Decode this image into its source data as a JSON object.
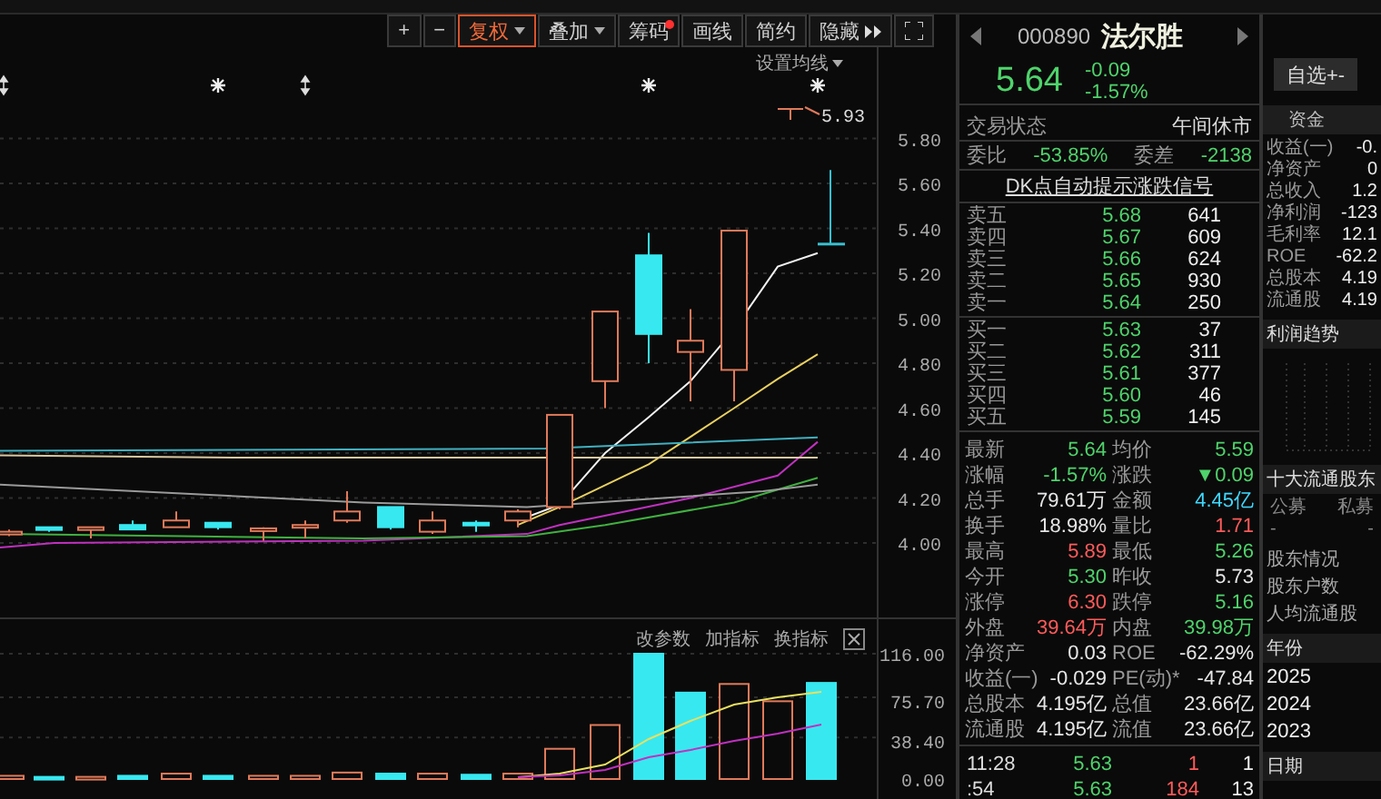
{
  "toolbar": {
    "buttons": [
      {
        "label": "+",
        "selected": false,
        "dropdown": false,
        "badge": false
      },
      {
        "label": "−",
        "selected": false,
        "dropdown": false,
        "badge": false
      },
      {
        "label": "复权",
        "selected": true,
        "dropdown": true,
        "badge": false
      },
      {
        "label": "叠加",
        "selected": false,
        "dropdown": true,
        "badge": false
      },
      {
        "label": "筹码",
        "selected": false,
        "dropdown": false,
        "badge": true
      },
      {
        "label": "画线",
        "selected": false,
        "dropdown": false,
        "badge": false
      },
      {
        "label": "简约",
        "selected": false,
        "dropdown": false,
        "badge": false
      },
      {
        "label": "隐藏",
        "selected": false,
        "dropdown": false,
        "badge": false
      }
    ]
  },
  "price_chart": {
    "ma_settings": "设置均线",
    "high_marker": "5.93",
    "axis": [
      "5.80",
      "5.60",
      "5.40",
      "5.20",
      "5.00",
      "4.80",
      "4.60",
      "4.40",
      "4.20",
      "4.00"
    ]
  },
  "volume_chart": {
    "actions": [
      "改参数",
      "加指标",
      "换指标"
    ],
    "axis": [
      "116.00",
      "75.70",
      "38.40",
      "0.00"
    ]
  },
  "quote": {
    "code": "000890",
    "name": "法尔胜",
    "price": "5.64",
    "change": "-0.09",
    "change_pct": "-1.57%",
    "status_label": "交易状态",
    "status": "午间休市",
    "ratio": [
      {
        "label": "委比",
        "value": "-53.85%"
      },
      {
        "label": "委差",
        "value": "-2138"
      }
    ],
    "signal_link": "DK点自动提示涨跌信号",
    "asks": [
      {
        "label": "卖五",
        "price": "5.68",
        "volume": "641"
      },
      {
        "label": "卖四",
        "price": "5.67",
        "volume": "609"
      },
      {
        "label": "卖三",
        "price": "5.66",
        "volume": "624"
      },
      {
        "label": "卖二",
        "price": "5.65",
        "volume": "930"
      },
      {
        "label": "卖一",
        "price": "5.64",
        "volume": "250"
      }
    ],
    "bids": [
      {
        "label": "买一",
        "price": "5.63",
        "volume": "37"
      },
      {
        "label": "买二",
        "price": "5.62",
        "volume": "311"
      },
      {
        "label": "买三",
        "price": "5.61",
        "volume": "377"
      },
      {
        "label": "买四",
        "price": "5.60",
        "volume": "46"
      },
      {
        "label": "买五",
        "price": "5.59",
        "volume": "145"
      }
    ],
    "stats": [
      [
        {
          "label": "最新",
          "value": "5.64",
          "color": "#4fd36b"
        },
        {
          "label": "均价",
          "value": "5.59",
          "color": "#4fd36b"
        }
      ],
      [
        {
          "label": "涨幅",
          "value": "-1.57%",
          "color": "#4fd36b"
        },
        {
          "label": "涨跌",
          "value": "▼0.09",
          "color": "#4fd36b"
        }
      ],
      [
        {
          "label": "总手",
          "value": "79.61万",
          "color": "#e6e6e6"
        },
        {
          "label": "金额",
          "value": "4.45亿",
          "color": "#3fd8ff"
        }
      ],
      [
        {
          "label": "换手",
          "value": "18.98%",
          "color": "#e6e6e6"
        },
        {
          "label": "量比",
          "value": "1.71",
          "color": "#ff5b5b"
        }
      ],
      [
        {
          "label": "最高",
          "value": "5.89",
          "color": "#ff5b5b"
        },
        {
          "label": "最低",
          "value": "5.26",
          "color": "#4fd36b"
        }
      ],
      [
        {
          "label": "今开",
          "value": "5.30",
          "color": "#4fd36b"
        },
        {
          "label": "昨收",
          "value": "5.73",
          "color": "#e6e6e6"
        }
      ],
      [
        {
          "label": "涨停",
          "value": "6.30",
          "color": "#ff5b5b"
        },
        {
          "label": "跌停",
          "value": "5.16",
          "color": "#4fd36b"
        }
      ],
      [
        {
          "label": "外盘",
          "value": "39.64万",
          "color": "#ff5b5b"
        },
        {
          "label": "内盘",
          "value": "39.98万",
          "color": "#4fd36b"
        }
      ],
      [
        {
          "label": "净资产",
          "value": "0.03",
          "color": "#e6e6e6"
        },
        {
          "label": "ROE",
          "value": "-62.29%",
          "color": "#e6e6e6"
        }
      ],
      [
        {
          "label": "收益(一)",
          "value": "-0.029",
          "color": "#e6e6e6"
        },
        {
          "label": "PE(动)*",
          "value": "-47.84",
          "color": "#e6e6e6"
        }
      ],
      [
        {
          "label": "总股本",
          "value": "4.195亿",
          "color": "#e6e6e6"
        },
        {
          "label": "总值",
          "value": "23.66亿",
          "color": "#e6e6e6"
        }
      ],
      [
        {
          "label": "流通股",
          "value": "4.195亿",
          "color": "#e6e6e6"
        },
        {
          "label": "流值",
          "value": "23.66亿",
          "color": "#e6e6e6"
        }
      ]
    ],
    "ticks": [
      {
        "time": "11:28",
        "price": "5.63",
        "volume": "1",
        "count": "1"
      },
      {
        "time": ":54",
        "price": "5.63",
        "volume": "184",
        "count": "13"
      }
    ]
  },
  "f10": {
    "watch_button": "自选+-",
    "tab": "资金",
    "finance": [
      {
        "label": "收益(一)",
        "value": "-0."
      },
      {
        "label": "净资产",
        "value": "0"
      },
      {
        "label": "总收入",
        "value": "1.2"
      },
      {
        "label": "净利润",
        "value": "-123"
      },
      {
        "label": "毛利率",
        "value": "12.1"
      },
      {
        "label": "ROE",
        "value": "-62.2"
      },
      {
        "label": "总股本",
        "value": "4.19"
      },
      {
        "label": "流通股",
        "value": "4.19"
      }
    ],
    "profit_trend": "利润趋势",
    "holders": "十大流通股东",
    "holder_columns": [
      "公募",
      "私募"
    ],
    "holder_values": [
      "-",
      "-"
    ],
    "shareholder_items": [
      "股东情况",
      "股东户数",
      "人均流通股"
    ],
    "year_header": "年份",
    "years": [
      "2025",
      "2024",
      "2023"
    ],
    "date_header": "日期"
  }
}
